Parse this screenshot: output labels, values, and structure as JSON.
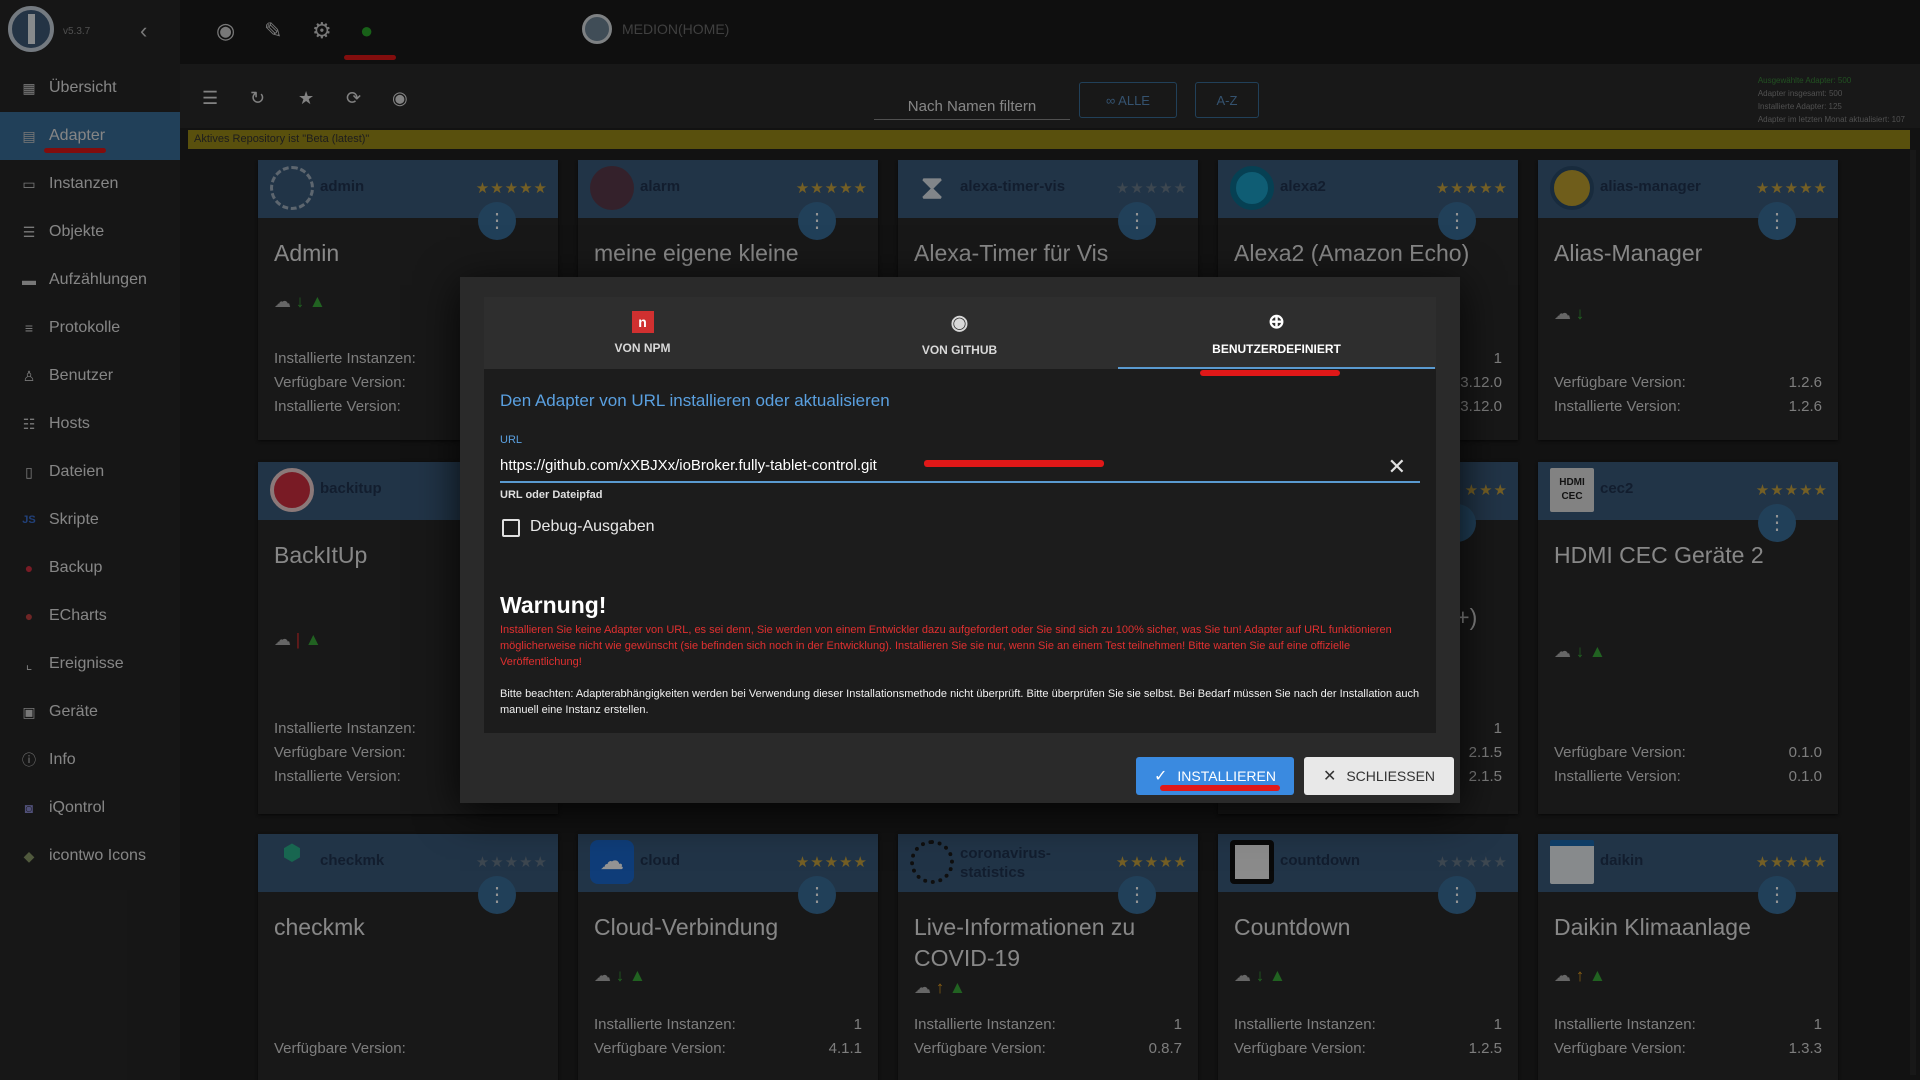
{
  "app": {
    "version": "v5.3.7"
  },
  "topbar": {
    "host": "MEDION(HOME)"
  },
  "sidebar": {
    "items": [
      {
        "label": "Übersicht",
        "icon": "grid-icon"
      },
      {
        "label": "Adapter",
        "icon": "store-icon"
      },
      {
        "label": "Instanzen",
        "icon": "instances-icon"
      },
      {
        "label": "Objekte",
        "icon": "list-icon"
      },
      {
        "label": "Aufzählungen",
        "icon": "enum-icon"
      },
      {
        "label": "Protokolle",
        "icon": "menu-icon"
      },
      {
        "label": "Benutzer",
        "icon": "person-icon"
      },
      {
        "label": "Hosts",
        "icon": "hosts-icon"
      },
      {
        "label": "Dateien",
        "icon": "file-icon"
      },
      {
        "label": "Skripte",
        "icon": "js-icon"
      },
      {
        "label": "Backup",
        "icon": "backup-icon"
      },
      {
        "label": "ECharts",
        "icon": "echarts-icon"
      },
      {
        "label": "Ereignisse",
        "icon": "events-icon"
      },
      {
        "label": "Geräte",
        "icon": "devices-icon"
      },
      {
        "label": "Info",
        "icon": "info-icon"
      },
      {
        "label": "iQontrol",
        "icon": "iqontrol-icon"
      },
      {
        "label": "icontwo Icons",
        "icon": "icontwo-icon"
      }
    ]
  },
  "toolbar": {
    "filter_placeholder": "Nach Namen filtern",
    "all_label": "∞ ALLE",
    "az_label": "A-Z"
  },
  "stats": {
    "line1": "Ausgewählte Adapter: 500",
    "line2": "Adapter insgesamt: 500",
    "line3": "Installierte Adapter: 125",
    "line4": "Adapter im letzten Monat aktualisiert: 107"
  },
  "repo_notice": "Aktives Repository ist \"Beta (latest)\"",
  "labels": {
    "installed_instances": "Installierte Instanzen:",
    "available_version": "Verfügbare Version:",
    "installed_version": "Installierte Version:"
  },
  "cards": [
    {
      "short": "admin",
      "title": "Admin"
    },
    {
      "short": "alarm",
      "title": "meine eigene kleine"
    },
    {
      "short": "alexa-timer-vis",
      "title": "Alexa-Timer für Vis"
    },
    {
      "short": "alexa2",
      "title": "Alexa2 (Amazon Echo)",
      "inst": "1",
      "avail": "3.12.0",
      "installed": "3.12.0"
    },
    {
      "short": "alias-manager",
      "title": "Alias-Manager",
      "avail": "1.2.6",
      "installed": "1.2.6"
    },
    {
      "short": "backitup",
      "title": "BackItUp"
    },
    {
      "partial_title": "LB+)",
      "inst": "1",
      "avail": "2.1.5",
      "installed": "2.1.5"
    },
    {
      "short": "cec2",
      "title": "HDMI CEC Geräte 2",
      "avail": "0.1.0",
      "installed": "0.1.0"
    },
    {
      "short": "checkmk",
      "title": "checkmk"
    },
    {
      "short": "cloud",
      "title": "Cloud-Verbindung",
      "inst": "1",
      "avail": "4.1.1"
    },
    {
      "short": "coronavirus-statistics",
      "title": "Live-Informationen zu COVID-19",
      "inst": "1",
      "avail": "0.8.7"
    },
    {
      "short": "countdown",
      "title": "Countdown",
      "inst": "1",
      "avail": "1.2.5"
    },
    {
      "short": "daikin",
      "title": "Daikin Klimaanlage",
      "inst": "1",
      "avail": "1.3.3"
    }
  ],
  "dialog": {
    "tabs": [
      "VON NPM",
      "VON GITHUB",
      "BENUTZERDEFINIERT"
    ],
    "heading": "Den Adapter von URL installieren oder aktualisieren",
    "url_label": "URL",
    "url_value": "https://github.com/xXBJXx/ioBroker.fully-tablet-control.git",
    "url_helper": "URL oder Dateipfad",
    "debug_label": "Debug-Ausgaben",
    "warning_title": "Warnung!",
    "warning_text": "Installieren Sie keine Adapter von URL, es sei denn, Sie werden von einem Entwickler dazu aufgefordert oder Sie sind sich zu 100% sicher, was Sie tun! Adapter auf URL funktionieren möglicherweise nicht wie gewünscht (sie befinden sich noch in der Entwicklung). Installieren Sie sie nur, wenn Sie an einem Test teilnehmen! Bitte warten Sie auf eine offizielle Veröffentlichung!",
    "note_text": "Bitte beachten: Adapterabhängigkeiten werden bei Verwendung dieser Installationsmethode nicht überprüft. Bitte überprüfen Sie sie selbst. Bei Bedarf müssen Sie nach der Installation auch manuell eine Instanz erstellen.",
    "install_label": "INSTALLIEREN",
    "close_label": "SCHLIESSEN"
  }
}
